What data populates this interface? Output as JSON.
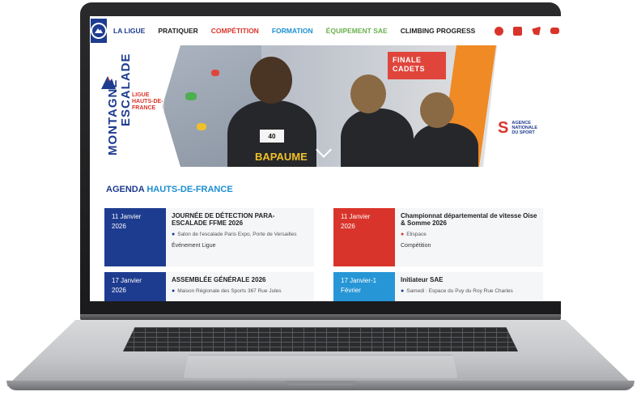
{
  "nav": {
    "links": [
      {
        "label": "LA LIGUE",
        "tone": "blue"
      },
      {
        "label": "PRATIQUER",
        "tone": "dark"
      },
      {
        "label": "COMPÉTITION",
        "tone": "red"
      },
      {
        "label": "FORMATION",
        "tone": "cyan"
      },
      {
        "label": "ÉQUIPEMENT SAE",
        "tone": "green"
      },
      {
        "label": "CLIMBING PROGRESS",
        "tone": "dark"
      }
    ],
    "social_icons": [
      "facebook-icon",
      "instagram-icon",
      "twitter-icon",
      "youtube-icon",
      "linkedin-icon"
    ]
  },
  "hero": {
    "brand_line1": "MONTAGNE",
    "brand_line2": "ESCALADE",
    "ligue_l1": "LIGUE",
    "ligue_l2": "HAUTS-DE-",
    "ligue_l3": "FRANCE",
    "banner_l1": "FINALE",
    "banner_l2": "CADETS",
    "bib_number": "40",
    "shirt_text": "BAPAUME",
    "ans_l1": "AGENCE",
    "ans_l2": "NATIONALE",
    "ans_l3": "DU SPORT"
  },
  "agenda": {
    "title_part1": "AGENDA",
    "title_part2": "HAUTS-DE-FRANCE",
    "events": [
      {
        "date_l1": "11 Janvier",
        "date_l2": "2026",
        "title": "JOURNÉE DE DÉTECTION PARA-ESCALADE FFME 2026",
        "location": "Salon de l'escalade Paris Expo, Porte de Versailles",
        "category": "Événement Ligue"
      },
      {
        "date_l1": "11 Janvier",
        "date_l2": "2026",
        "title": "Championnat départemental de vitesse Oise & Somme 2026",
        "location": "Elispace",
        "category": "Compétition"
      },
      {
        "date_l1": "17 Janvier",
        "date_l2": "2026",
        "title": "ASSEMBLÉE GÉNÉRALE 2026",
        "location": "Maison Régionale des Sports 367 Rue Jules",
        "category": ""
      },
      {
        "date_l1": "17 Janvier-1",
        "date_l2": "Février",
        "title": "Initiateur SAE",
        "location": "Samedi : Espace du Puy du Roy Rue Charles",
        "category": ""
      }
    ]
  },
  "colors": {
    "brand_blue": "#1e3c8f",
    "brand_red": "#d9342b",
    "accent_cyan": "#1c8fd1",
    "accent_green": "#6ab04c"
  }
}
